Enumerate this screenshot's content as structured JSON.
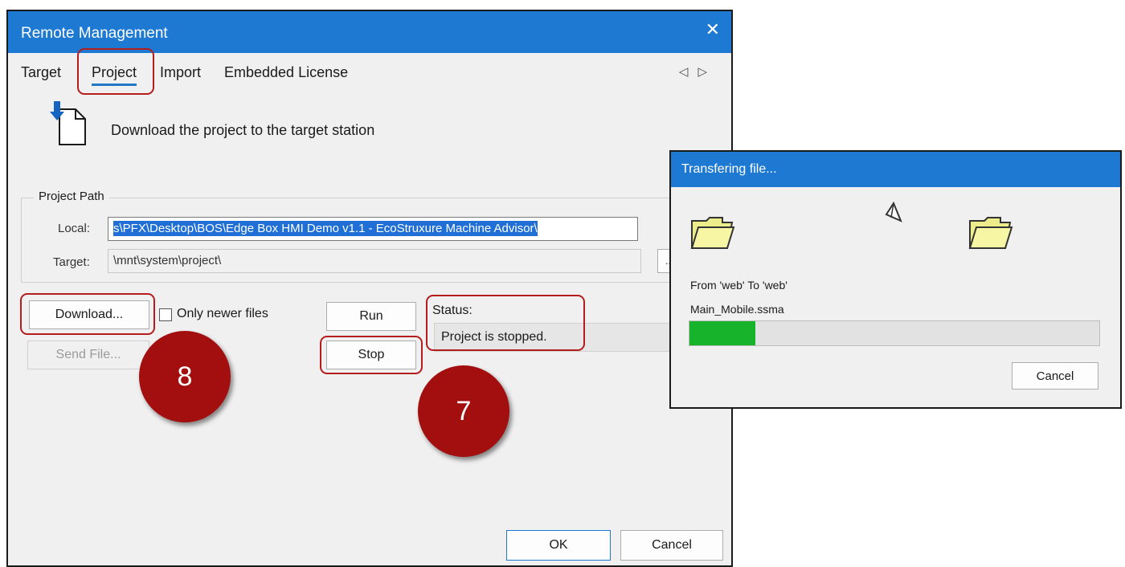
{
  "main_dialog": {
    "title": "Remote Management",
    "close_glyph": "✕",
    "tabs": [
      {
        "label": "Target"
      },
      {
        "label": "Project",
        "active": true
      },
      {
        "label": "Import"
      },
      {
        "label": "Embedded License"
      }
    ],
    "tab_scroll": {
      "left": "◁",
      "right": "▷"
    },
    "header": {
      "icon": "download-icon",
      "text": "Download the project to the target station"
    },
    "project_path": {
      "group_label": "Project Path",
      "local_label": "Local:",
      "local_value": "s\\PFX\\Desktop\\BOS\\Edge Box HMI Demo v1.1 -  EcoStruxure Machine Advisor\\",
      "target_label": "Target:",
      "target_value": "\\mnt\\system\\project\\",
      "browse_label": "..."
    },
    "download_button": "Download...",
    "only_newer_label": "Only newer files",
    "send_file_button": "Send File...",
    "run_button": "Run",
    "stop_button": "Stop",
    "status_label": "Status:",
    "status_value": "Project is stopped.",
    "ok_button": "OK",
    "cancel_button": "Cancel"
  },
  "callouts": [
    {
      "label": "8"
    },
    {
      "label": "7"
    }
  ],
  "colors": {
    "titlebar": "#1e79d2",
    "highlight": "#b51c1c",
    "badge": "#a30f0f",
    "progress": "#17b32b"
  },
  "transfer_dialog": {
    "title": "Transfering file...",
    "icons": [
      "folder-icon",
      "paper-plane-icon",
      "folder-icon"
    ],
    "from_to": "From 'web' To 'web'",
    "filename": "Main_Mobile.ssma",
    "progress_percent": 16,
    "cancel_button": "Cancel"
  }
}
